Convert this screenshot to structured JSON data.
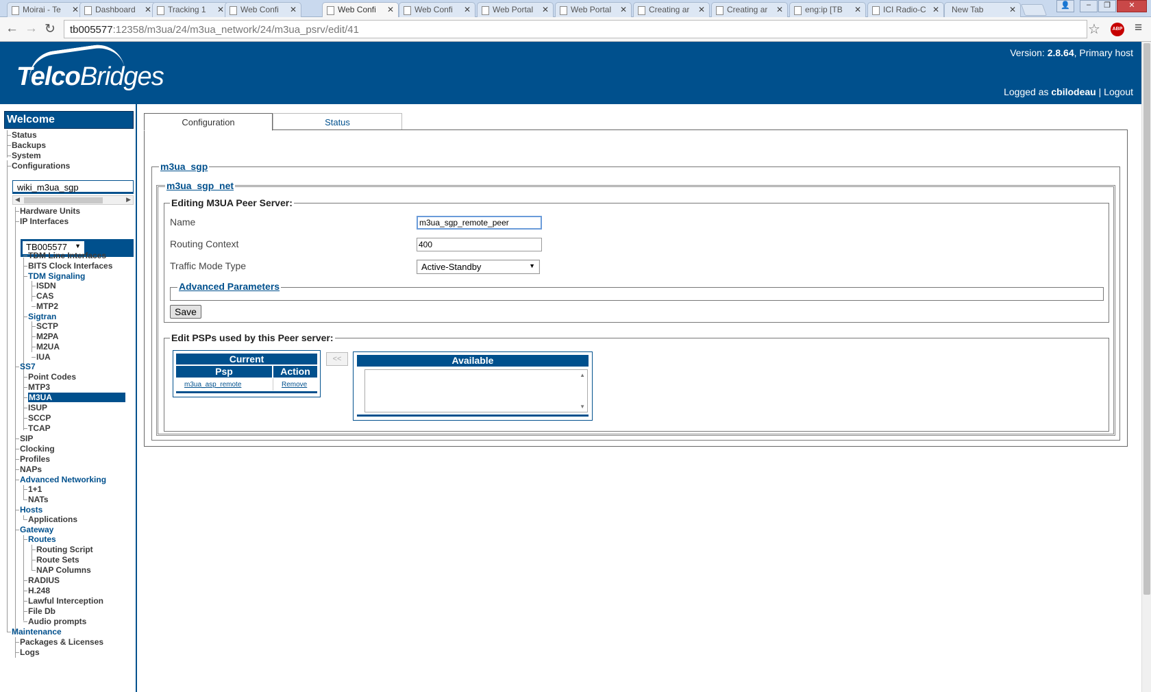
{
  "browser": {
    "tabs": [
      {
        "label": "Moirai - Te"
      },
      {
        "label": "Dashboard"
      },
      {
        "label": "Tracking 1"
      },
      {
        "label": "Web Confi"
      },
      {
        "label": "Web Confi"
      },
      {
        "label": "Web Confi"
      },
      {
        "label": "Web Portal"
      },
      {
        "label": "Web Portal"
      },
      {
        "label": "Creating ar"
      },
      {
        "label": "Creating ar"
      },
      {
        "label": "eng:ip [TB"
      },
      {
        "label": "ICI Radio-C"
      },
      {
        "label": "New Tab"
      }
    ],
    "active_tab_index": 4,
    "url_host": "tb005577",
    "url_rest": ":12358/m3ua/24/m3ua_network/24/m3ua_psrv/edit/41",
    "abp_label": "ABP"
  },
  "header": {
    "logo_bold": "Telco",
    "logo_rest": "Bridges",
    "version_prefix": "Version: ",
    "version_value": "2.8.64",
    "version_suffix": ", Primary host",
    "logged_prefix": "Logged as ",
    "user": "cbilodeau",
    "separator": " | ",
    "logout": "Logout"
  },
  "sidebar": {
    "welcome": "Welcome",
    "top_items": [
      "Status",
      "Backups",
      "System",
      "Configurations"
    ],
    "config_name": "wiki_m3ua_sgp",
    "config_items": [
      "Hardware Units",
      "IP Interfaces"
    ],
    "host": "TB005577",
    "tdm": [
      "TDM Line Interfaces",
      "BITS Clock Interfaces",
      "TDM Signaling"
    ],
    "tdm_sig": [
      "ISDN",
      "CAS",
      "MTP2"
    ],
    "sigtran": "Sigtran",
    "sigtran_items": [
      "SCTP",
      "M2PA",
      "M2UA",
      "IUA"
    ],
    "ss7": "SS7",
    "ss7_items": [
      "Point Codes",
      "MTP3",
      "M3UA",
      "ISUP",
      "SCCP",
      "TCAP"
    ],
    "mid_items": [
      "SIP",
      "Clocking",
      "Profiles",
      "NAPs"
    ],
    "adv_net": "Advanced Networking",
    "adv_items": [
      "1+1",
      "NATs"
    ],
    "hosts": "Hosts",
    "hosts_items": [
      "Applications"
    ],
    "gateway": "Gateway",
    "routes": "Routes",
    "routes_items": [
      "Routing Script",
      "Route Sets",
      "NAP Columns"
    ],
    "gw_items": [
      "RADIUS",
      "H.248",
      "Lawful Interception",
      "File Db",
      "Audio prompts"
    ],
    "maintenance": "Maintenance",
    "maint_items": [
      "Packages & Licenses",
      "Logs"
    ]
  },
  "main": {
    "tabs": [
      "Configuration",
      "Status"
    ],
    "legend_sgp": "m3ua_sgp",
    "legend_net": "m3ua_sgp_net",
    "legend_edit": "Editing M3UA Peer Server:",
    "fields": {
      "name_label": "Name",
      "name_value": "m3ua_sgp_remote_peer",
      "rc_label": "Routing Context",
      "rc_value": "400",
      "tmt_label": "Traffic Mode Type",
      "tmt_value": "Active-Standby"
    },
    "adv_params": "Advanced Parameters",
    "save": "Save",
    "psp_legend": "Edit PSPs used by this Peer server:",
    "current": {
      "title": "Current",
      "col_psp": "Psp",
      "col_action": "Action",
      "rows": [
        {
          "psp": "m3ua_asp_remote",
          "action": "Remove"
        }
      ]
    },
    "move_btn": "<<",
    "available": {
      "title": "Available"
    }
  }
}
